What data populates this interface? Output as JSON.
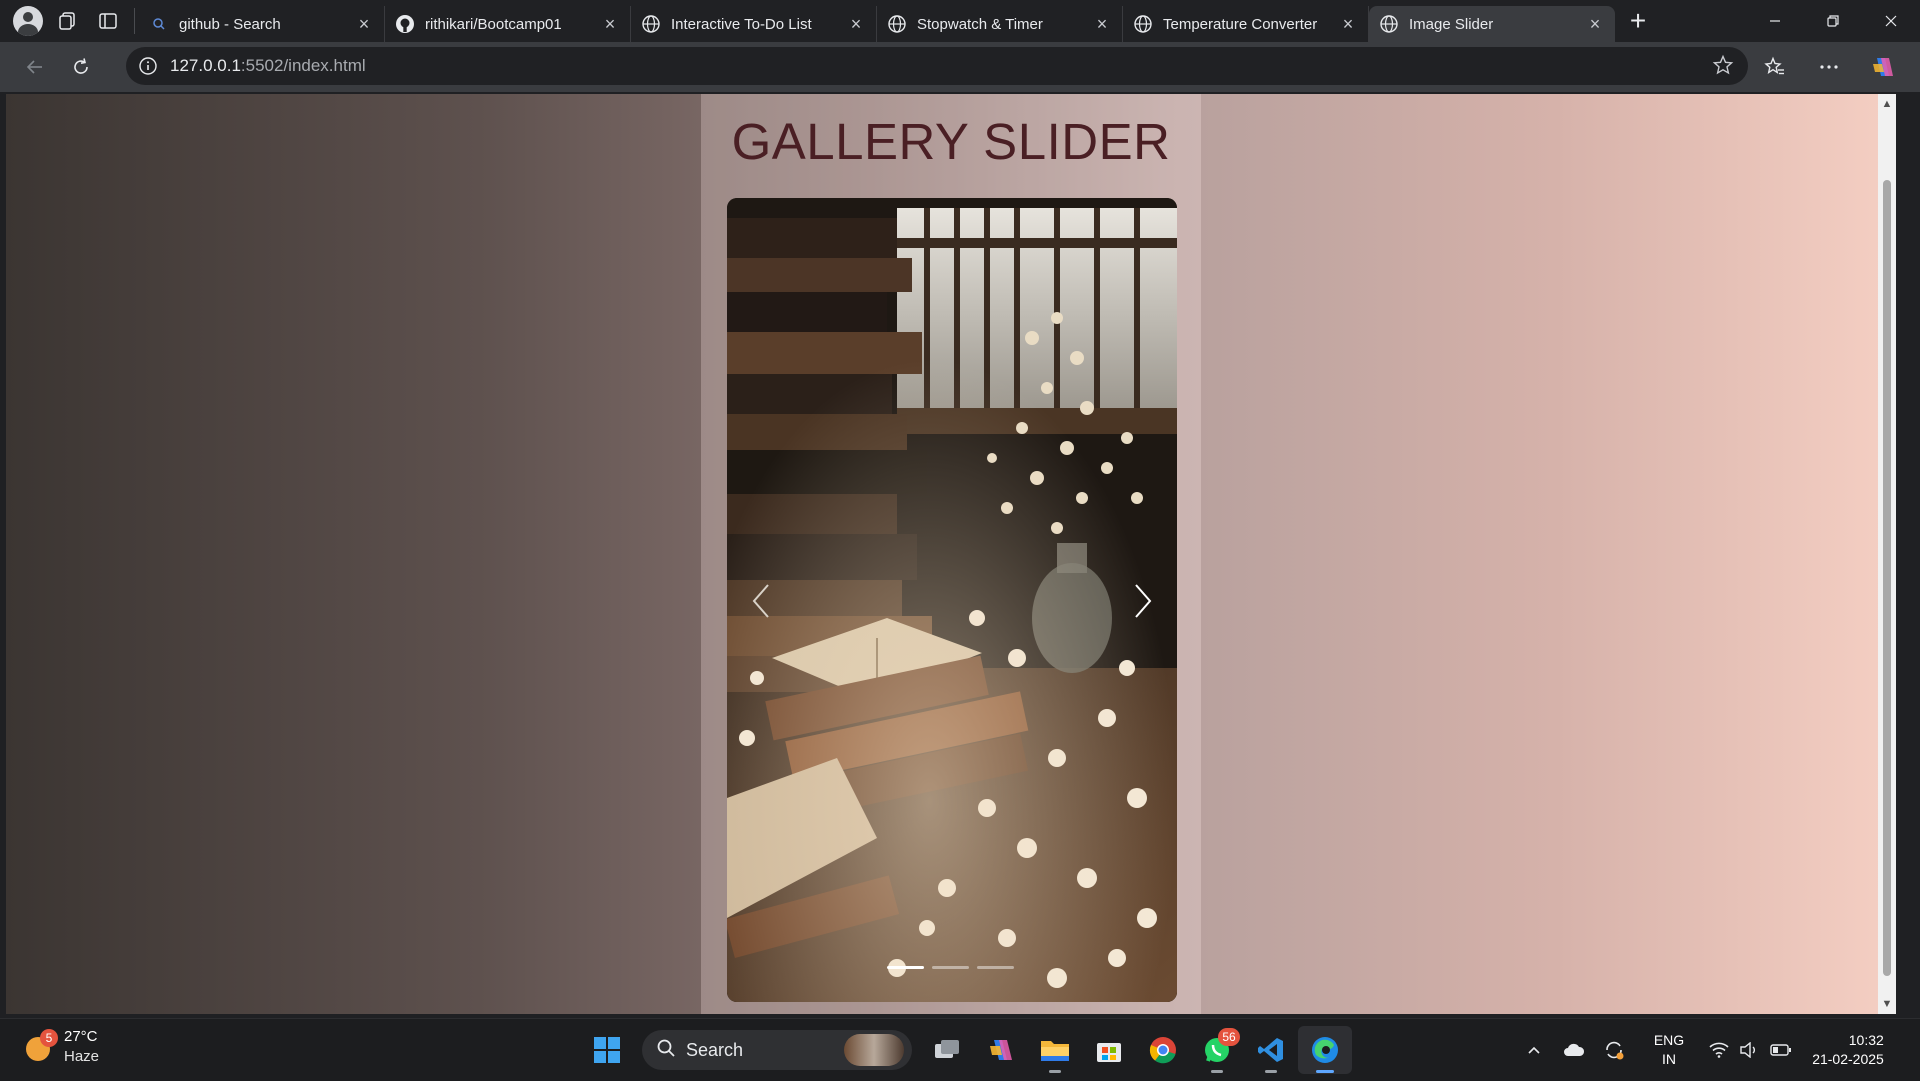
{
  "browser": {
    "tabs": [
      {
        "label": "github - Search",
        "icon": "search-icon",
        "active": false
      },
      {
        "label": "rithikari/Bootcamp01",
        "icon": "github-icon",
        "active": false
      },
      {
        "label": "Interactive To-Do List",
        "icon": "globe-icon",
        "active": false
      },
      {
        "label": "Stopwatch & Timer",
        "icon": "globe-icon",
        "active": false
      },
      {
        "label": "Temperature Converter",
        "icon": "globe-icon",
        "active": false
      },
      {
        "label": "Image Slider",
        "icon": "globe-icon",
        "active": true
      }
    ],
    "address": {
      "host": "127.0.0.1",
      "path": ":5502/index.html"
    }
  },
  "page": {
    "title": "GALLERY SLIDER",
    "slider": {
      "current_slide": 1,
      "total_slides": 3,
      "image_description_icon": "books-and-flowers-photo"
    },
    "colors": {
      "title": "#4a1f24",
      "gradient_start": "#3b3532",
      "gradient_end": "#f5cfc3"
    }
  },
  "taskbar": {
    "weather": {
      "temp": "27°C",
      "condition": "Haze",
      "badge": "5"
    },
    "search_label": "Search",
    "whatsapp_badge": "56",
    "language": {
      "line1": "ENG",
      "line2": "IN"
    },
    "clock": {
      "time": "10:32",
      "date": "21-02-2025"
    }
  }
}
